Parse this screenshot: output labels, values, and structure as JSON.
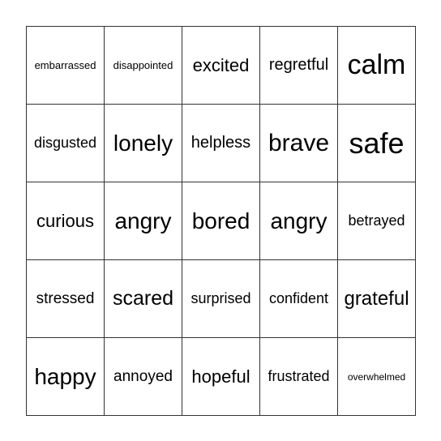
{
  "card": {
    "cells": [
      "embarrassed",
      "disappointed",
      "excited",
      "regretful",
      "calm",
      "disgusted",
      "lonely",
      "helpless",
      "brave",
      "safe",
      "curious",
      "angry",
      "bored",
      "angry",
      "betrayed",
      "stressed",
      "scared",
      "surprised",
      "confident",
      "grateful",
      "happy",
      "annoyed",
      "hopeful",
      "frustrated",
      "overwhelmed"
    ]
  }
}
